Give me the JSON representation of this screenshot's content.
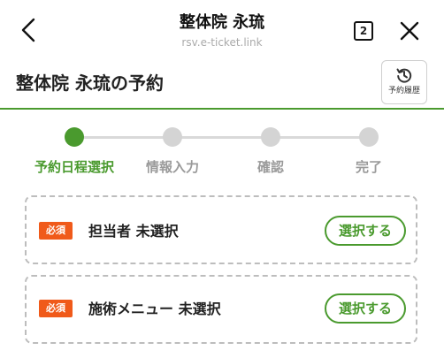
{
  "browser": {
    "title": "整体院 永琉",
    "url": "rsv.e-ticket.link",
    "tab_count": "2",
    "back_icon": "chevron-left-icon",
    "close_icon": "close-icon"
  },
  "header": {
    "title": "整体院 永琉の予約",
    "history_label": "予約履歴",
    "history_icon": "history-icon"
  },
  "steps": [
    {
      "label": "予約日程選択",
      "active": true
    },
    {
      "label": "情報入力",
      "active": false
    },
    {
      "label": "確認",
      "active": false
    },
    {
      "label": "完了",
      "active": false
    }
  ],
  "sections": [
    {
      "badge": "必須",
      "label": "担当者 未選択",
      "button": "選択する"
    },
    {
      "badge": "必須",
      "label": "施術メニュー 未選択",
      "button": "選択する"
    }
  ],
  "colors": {
    "accent": "#4a9a2e",
    "required": "#f05a1a",
    "inactive": "#d4d4d4"
  }
}
